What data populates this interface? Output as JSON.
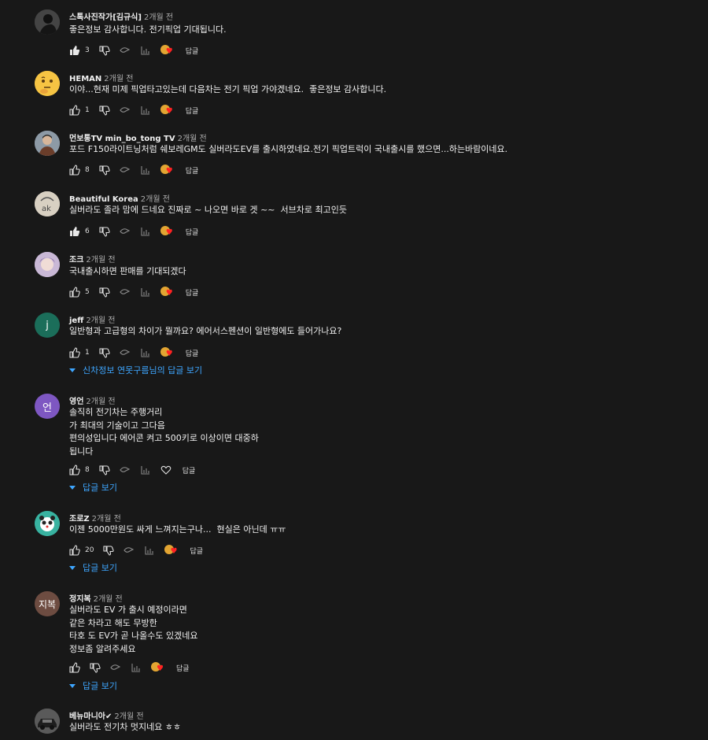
{
  "comments": [
    {
      "author": "스톡사진작가[김규식]",
      "time": "2개월 전",
      "text": "좋은정보 감사합니다. 전기픽업 기대됩니다.",
      "likes": "3",
      "reply_label": "답글",
      "avatar_icon": "dark-figure-avatar"
    },
    {
      "author": "HEMAN",
      "time": "2개월 전",
      "text": "이야...현재 미제 픽업타고있는데 다음차는 전기 픽업 가야겠네요.  좋은정보 감사합니다.",
      "likes": "1",
      "reply_label": "답글",
      "avatar_icon": "thinking-emoji-avatar"
    },
    {
      "author": "먼보통TV min_bo_tong TV",
      "time": "2개월 전",
      "text": "포드 F150라이트닝처럼 쉐보레GM도 실버라도EV를 출시하였네요.전기 픽업트럭이 국내출시를 했으면...하는바람이네요.",
      "likes": "8",
      "reply_label": "답글",
      "avatar_icon": "person-avatar"
    },
    {
      "author": "Beautiful Korea",
      "time": "2개월 전",
      "text": "실버라도 졸라 맘에 드네요 진짜로 ~ 나오면 바로 겟 ~~  서브차로 최고인듯",
      "likes": "6",
      "reply_label": "답글",
      "avatar_icon": "bk-logo-avatar"
    },
    {
      "author": "조크",
      "time": "2개월 전",
      "text": "국내출시하면 판매를 기대되겠다",
      "likes": "5",
      "reply_label": "답글",
      "avatar_icon": "anime-avatar"
    },
    {
      "author": "jeff",
      "time": "2개월 전",
      "text": "일반형과 고급형의 차이가 뭘까요? 에어서스펜션이 일반형에도 들어가나요?",
      "likes": "1",
      "reply_label": "답글",
      "avatar_letter": "j",
      "view_replies": "신차정보 연못구름님의 답글 보기"
    },
    {
      "author": "영언",
      "time": "2개월 전",
      "text": "솔직히 전기차는 주행거리\n가 최대의 기술이고 그다음\n편의성입니다 에어콘 켜고 500키로 이상이면 대중하\n됩니다",
      "likes": "8",
      "reply_label": "답글",
      "avatar_letter": "언",
      "view_replies": "답글 보기"
    },
    {
      "author": "조로Z",
      "time": "2개월 전",
      "text": "이젠 5000만원도 싸게 느껴지는구나...  현실은 아닌데 ㅠㅠ",
      "likes": "20",
      "reply_label": "답글",
      "avatar_icon": "panda-avatar",
      "view_replies": "답글 보기"
    },
    {
      "author": "정지복",
      "time": "2개월 전",
      "text": "실버라도 EV 가 출시 예정이라면\n같은 차라고 해도 무방한\n타호 도 EV가 곧 나올수도 있겠네요\n정보좀 알려주세요",
      "likes": "",
      "reply_label": "답글",
      "avatar_letter": "지복",
      "view_replies": "답글 보기"
    },
    {
      "author": "베뉴마니아✔",
      "time": "2개월 전",
      "text": "실버라도 전기차 멋지네요 ㅎㅎ",
      "avatar_icon": "car-avatar"
    }
  ],
  "colors": {
    "background": "#181818",
    "link": "#3ea6ff",
    "heart": "#ff2222"
  }
}
